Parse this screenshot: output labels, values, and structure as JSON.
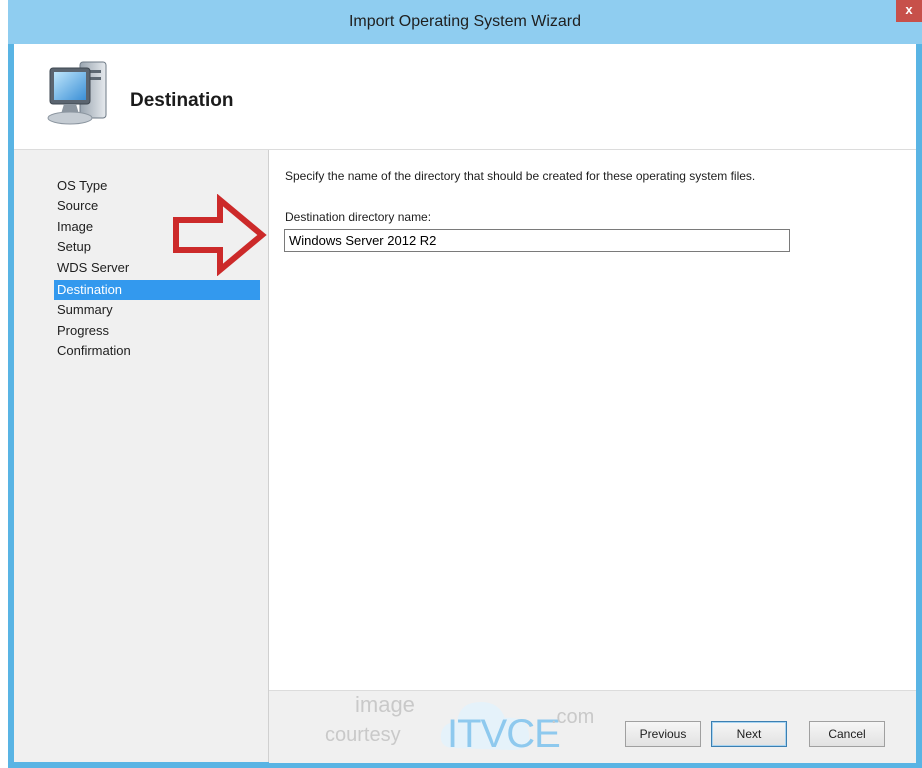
{
  "window": {
    "title": "Import Operating System Wizard",
    "close_glyph": "x"
  },
  "header": {
    "title": "Destination",
    "icon": "computer-icon"
  },
  "nav": {
    "items": [
      {
        "label": "OS Type",
        "active": false
      },
      {
        "label": "Source",
        "active": false
      },
      {
        "label": "Image",
        "active": false
      },
      {
        "label": "Setup",
        "active": false
      },
      {
        "label": "WDS Server",
        "active": false
      },
      {
        "label": "Destination",
        "active": true
      },
      {
        "label": "Summary",
        "active": false
      },
      {
        "label": "Progress",
        "active": false
      },
      {
        "label": "Confirmation",
        "active": false
      }
    ]
  },
  "content": {
    "instruction": "Specify the name of the directory that should be created for these operating system files.",
    "field_label": "Destination directory name:",
    "field_value": "Windows Server 2012 R2"
  },
  "footer": {
    "previous_label": "Previous",
    "next_label": "Next",
    "cancel_label": "Cancel"
  },
  "watermark": {
    "line1": "image",
    "line2": "courtesy",
    "brand": "ITVCE",
    "suffix": ".com"
  },
  "colors": {
    "accent": "#3399ee",
    "window_frame": "#59b4e4",
    "arrow": "#cc2a2a"
  }
}
